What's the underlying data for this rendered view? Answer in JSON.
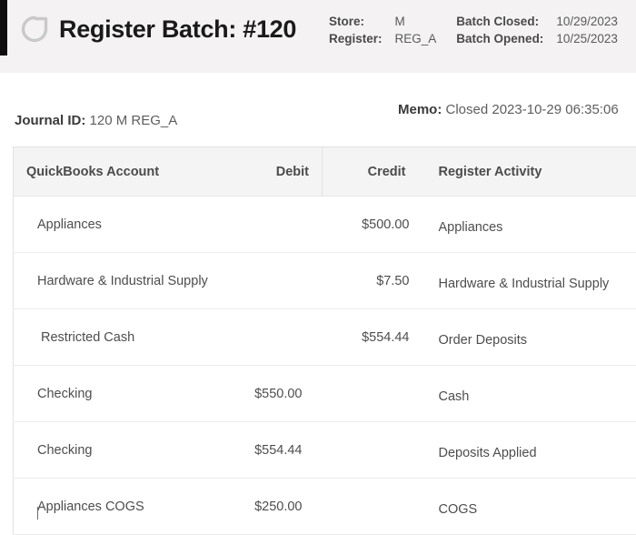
{
  "header": {
    "refresh_icon": "refresh-circular-arrow-icon",
    "title": "Register Batch: #120",
    "meta": {
      "store_label": "Store:",
      "store_value": "M",
      "register_label": "Register:",
      "register_value": "REG_A",
      "batch_closed_label": "Batch Closed:",
      "batch_closed_value": "10/29/2023",
      "batch_opened_label": "Batch Opened:",
      "batch_opened_value": "10/25/2023"
    }
  },
  "subhead": {
    "journal_label": "Journal ID:",
    "journal_value": "120 M REG_A",
    "memo_label": "Memo:",
    "memo_value": "Closed 2023-10-29 06:35:06"
  },
  "table": {
    "columns": [
      "QuickBooks Account",
      "Debit",
      "Credit",
      "Register Activity"
    ],
    "rows": [
      {
        "account": "Appliances",
        "debit": "",
        "credit": "$500.00",
        "activity": "Appliances"
      },
      {
        "account": "Hardware & Industrial Supply",
        "debit": "",
        "credit": "$7.50",
        "activity": "Hardware & Industrial Supply"
      },
      {
        "account": "Restricted Cash",
        "debit": "",
        "credit": "$554.44",
        "activity": "Order Deposits"
      },
      {
        "account": "Checking",
        "debit": "$550.00",
        "credit": "",
        "activity": "Cash"
      },
      {
        "account": "Checking",
        "debit": "$554.44",
        "credit": "",
        "activity": "Deposits Applied"
      },
      {
        "account": "Appliances COGS",
        "debit": "$250.00",
        "credit": "",
        "activity": "COGS"
      }
    ]
  },
  "colors": {
    "header_band": "#f4f2f3",
    "accent_bar": "#0d0d0d",
    "table_header_bg": "#f5f4f4",
    "text_primary": "#3c3c3c",
    "text_muted": "#5d5d5d"
  }
}
